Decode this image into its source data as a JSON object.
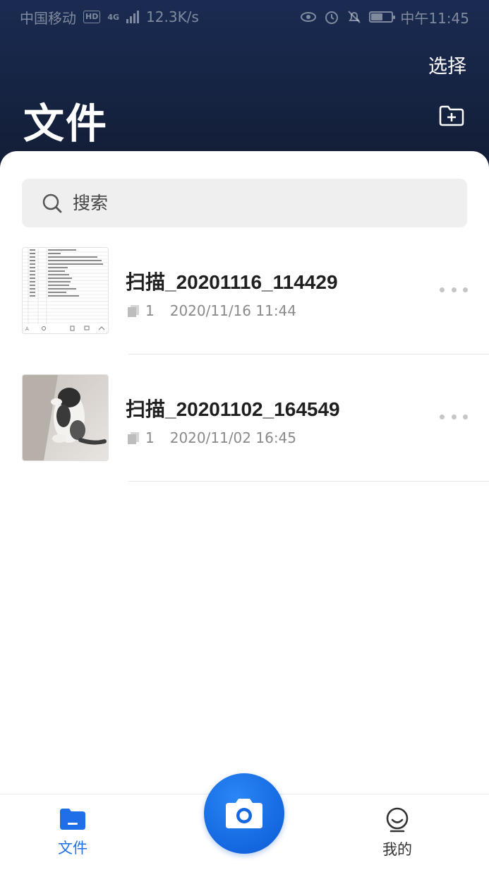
{
  "status_bar": {
    "carrier": "中国移动",
    "hd": "HD",
    "network": "4G",
    "speed": "12.3K/s",
    "time": "中午11:45",
    "battery_level": 0.55
  },
  "header": {
    "select_label": "选择",
    "title": "文件"
  },
  "search": {
    "placeholder": "搜索"
  },
  "files": [
    {
      "name": "扫描_20201116_114429",
      "pages": "1",
      "date": "2020/11/16 11:44",
      "thumbnail": "document-scan"
    },
    {
      "name": "扫描_20201102_164549",
      "pages": "1",
      "date": "2020/11/02 16:45",
      "thumbnail": "cat-photo"
    }
  ],
  "tab_bar": {
    "files_label": "文件",
    "mine_label": "我的"
  },
  "colors": {
    "accent": "#1e6fe8",
    "header_bg": "#15223f"
  }
}
